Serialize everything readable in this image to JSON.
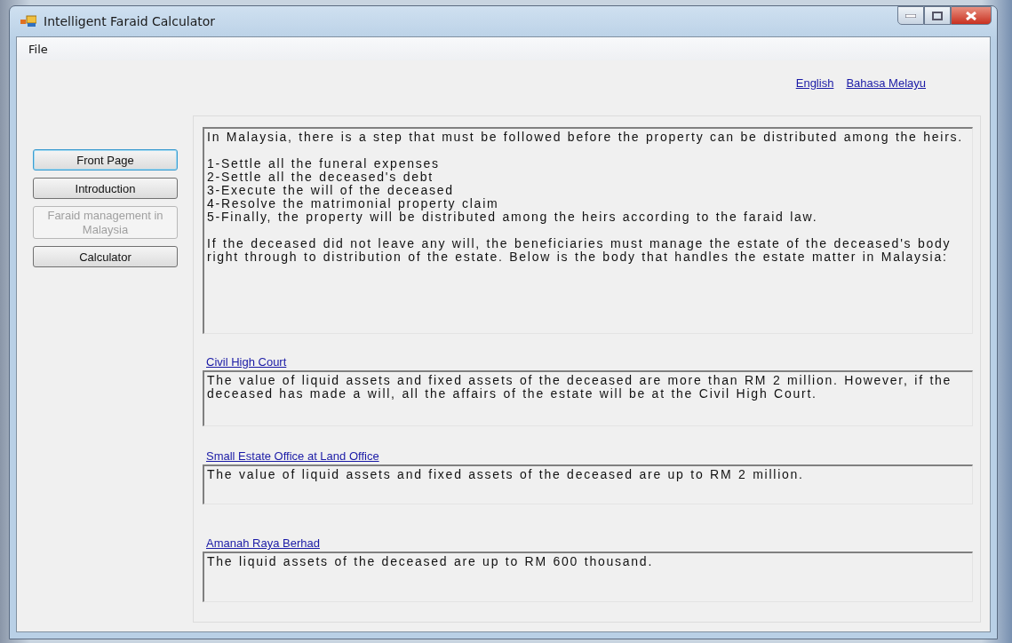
{
  "window": {
    "title": "Intelligent Faraid Calculator"
  },
  "menu": [
    "File"
  ],
  "language_links": [
    "English",
    "Bahasa Melayu"
  ],
  "nav_buttons": [
    {
      "label": "Front Page",
      "selected": true,
      "disabled": false
    },
    {
      "label": "Introduction",
      "selected": false,
      "disabled": false
    },
    {
      "label": "Faraid management in Malaysia",
      "selected": false,
      "disabled": true
    },
    {
      "label": "Calculator",
      "selected": false,
      "disabled": false
    }
  ],
  "intro_text": "In Malaysia, there is a step that must be followed before the property can be distributed among the heirs.\n\n1-Settle all the funeral expenses\n2-Settle all the deceased's debt\n3-Execute the will of the deceased\n4-Resolve the matrimonial property claim\n5-Finally, the property will be distributed among the heirs according to the faraid law.\n\nIf the deceased did not leave any will, the beneficiaries must manage the estate of the deceased's body right through to distribution of the estate. Below is the body that handles the estate matter in Malaysia:",
  "bodies": [
    {
      "link": "Civil High Court",
      "text": "The value of liquid assets and fixed assets of the deceased are more than RM 2 million. However, if the deceased has made a will, all the affairs of the estate will be at the Civil High Court."
    },
    {
      "link": "Small Estate Office at Land Office",
      "text": "The value of liquid assets and fixed assets of the deceased are up to RM 2 million."
    },
    {
      "link": "Amanah Raya Berhad",
      "text": "The liquid assets of the deceased are up to RM 600 thousand."
    }
  ]
}
